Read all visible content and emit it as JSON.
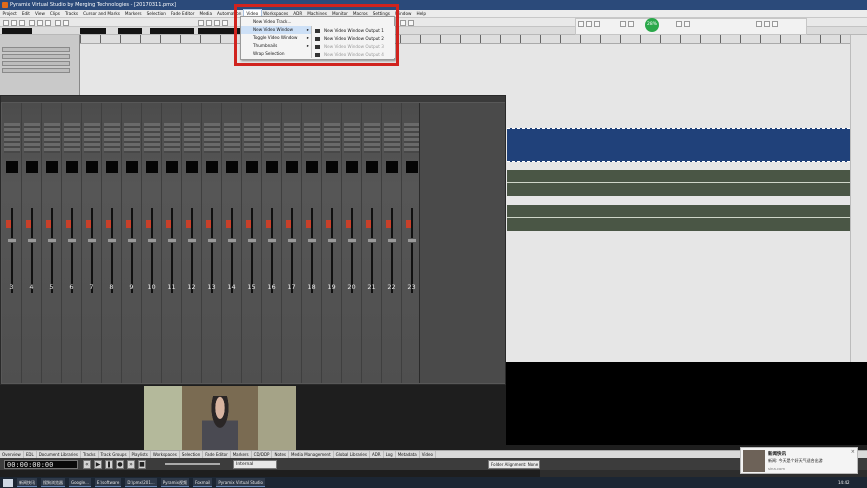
{
  "titlebar": {
    "title": "Pyramix Virtual Studio by Merging Technologies - [20170311.pmx]"
  },
  "menubar": {
    "items": [
      "Project",
      "Edit",
      "View",
      "Clips",
      "Tracks",
      "Cursor and Marks",
      "Markers",
      "Selection",
      "Fade Editor",
      "Media",
      "Automation",
      "Video",
      "Workspaces",
      "ADR",
      "Machines",
      "Monitor",
      "Macros",
      "Settings",
      "Window",
      "Help"
    ]
  },
  "green_indicator": {
    "value": "28%"
  },
  "video_menu": {
    "items": [
      {
        "label": "New Video Track...",
        "submenu": false
      },
      {
        "label": "New Video Window",
        "submenu": true
      },
      {
        "label": "Toggle Video Window",
        "submenu": true
      },
      {
        "label": "Thumbnails",
        "submenu": true
      },
      {
        "label": "Wrap Selection",
        "submenu": false
      }
    ],
    "submenu": [
      "New Video Window Output 1",
      "New Video Window Output 2",
      "New Video Window Output 3",
      "New Video Window Output 4"
    ]
  },
  "mixer": {
    "channel_numbers": [
      "3",
      "4",
      "5",
      "6",
      "7",
      "8",
      "9",
      "10",
      "11",
      "12",
      "13",
      "14",
      "15",
      "16",
      "17",
      "18",
      "19",
      "20",
      "21",
      "22",
      "23"
    ]
  },
  "bottom_tabs": [
    "Overview",
    "EDL",
    "Document Libraries",
    "Tracks",
    "Track Groups",
    "Playlists",
    "Workspaces",
    "Selection",
    "Fade Editor",
    "Markers",
    "CD/DDP",
    "Notes",
    "Media Management",
    "Global Libraries",
    "ADR",
    "Log",
    "Metadata",
    "Video"
  ],
  "transport": {
    "timecode": "00:00:00:00",
    "mode_label": "Internal",
    "alignment_label": "Folder Alignment: None"
  },
  "notification": {
    "title": "新闻快讯",
    "body": "新闻: 今天是个好天气适合出游",
    "source": "sina.com"
  },
  "taskbar": {
    "apps": [
      "新闻快讯",
      "搜狗浏览器",
      "Google...",
      "E:\\software",
      "D:\\pmx\\201...",
      "Pyramix视频",
      "Foxmail",
      "Pyramix Virtual Studio"
    ],
    "clock": "14:42"
  }
}
